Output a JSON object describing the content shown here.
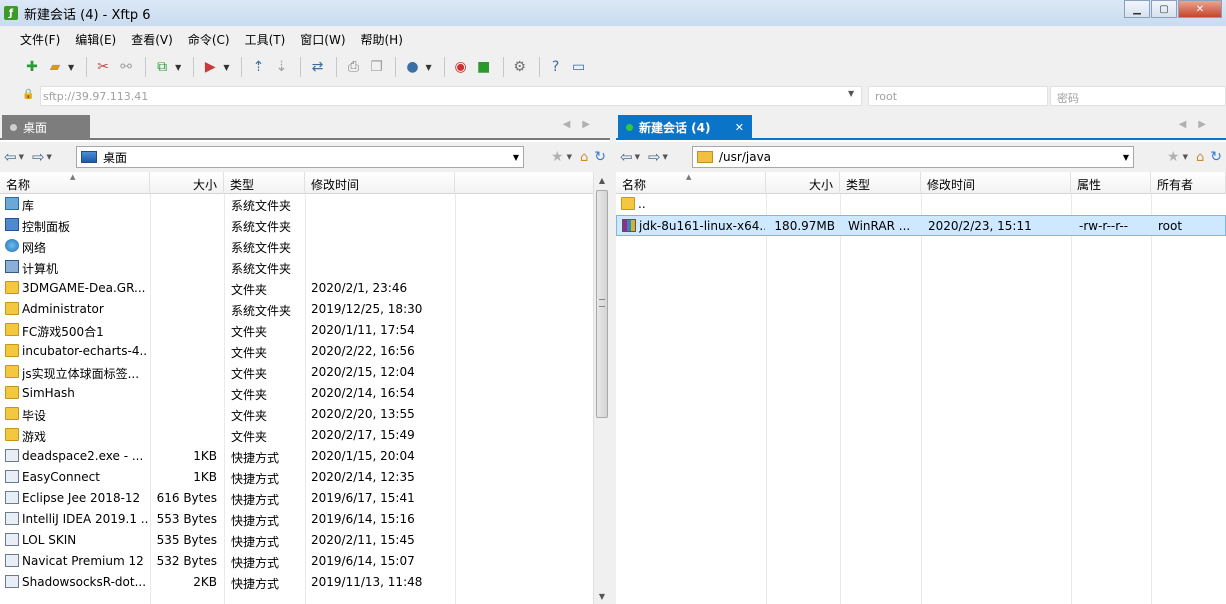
{
  "window": {
    "title": "新建会话 (4) - Xftp 6",
    "app_icon": "xftp-app-icon"
  },
  "menu": [
    "文件(F)",
    "编辑(E)",
    "查看(V)",
    "命令(C)",
    "工具(T)",
    "窗口(W)",
    "帮助(H)"
  ],
  "address": {
    "host": "sftp://39.97.113.41",
    "user_placeholder": "root",
    "password_placeholder": "密码"
  },
  "left": {
    "tab_label": "桌面",
    "path": "桌面",
    "columns": {
      "name": "名称",
      "size": "大小",
      "type": "类型",
      "modified": "修改时间"
    },
    "rows": [
      {
        "icon": "library",
        "name": "库",
        "size": "",
        "type": "系统文件夹",
        "modified": ""
      },
      {
        "icon": "control",
        "name": "控制面板",
        "size": "",
        "type": "系统文件夹",
        "modified": ""
      },
      {
        "icon": "network",
        "name": "网络",
        "size": "",
        "type": "系统文件夹",
        "modified": ""
      },
      {
        "icon": "computer",
        "name": "计算机",
        "size": "",
        "type": "系统文件夹",
        "modified": ""
      },
      {
        "icon": "folder",
        "name": "3DMGAME-Dea.GR...",
        "size": "",
        "type": "文件夹",
        "modified": "2020/2/1, 23:46"
      },
      {
        "icon": "folder",
        "name": "Administrator",
        "size": "",
        "type": "系统文件夹",
        "modified": "2019/12/25, 18:30"
      },
      {
        "icon": "folder",
        "name": "FC游戏500合1",
        "size": "",
        "type": "文件夹",
        "modified": "2020/1/11, 17:54"
      },
      {
        "icon": "folder",
        "name": "incubator-echarts-4...",
        "size": "",
        "type": "文件夹",
        "modified": "2020/2/22, 16:56"
      },
      {
        "icon": "folder",
        "name": "js实现立体球面标签...",
        "size": "",
        "type": "文件夹",
        "modified": "2020/2/15, 12:04"
      },
      {
        "icon": "folder",
        "name": "SimHash",
        "size": "",
        "type": "文件夹",
        "modified": "2020/2/14, 16:54"
      },
      {
        "icon": "folder",
        "name": "毕设",
        "size": "",
        "type": "文件夹",
        "modified": "2020/2/20, 13:55"
      },
      {
        "icon": "folder",
        "name": "游戏",
        "size": "",
        "type": "文件夹",
        "modified": "2020/2/17, 15:49"
      },
      {
        "icon": "shortcut",
        "name": "deadspace2.exe - ...",
        "size": "1KB",
        "type": "快捷方式",
        "modified": "2020/1/15, 20:04"
      },
      {
        "icon": "shortcut",
        "name": "EasyConnect",
        "size": "1KB",
        "type": "快捷方式",
        "modified": "2020/2/14, 12:35"
      },
      {
        "icon": "shortcut",
        "name": "Eclipse Jee 2018-12",
        "size": "616 Bytes",
        "type": "快捷方式",
        "modified": "2019/6/17, 15:41"
      },
      {
        "icon": "shortcut",
        "name": "IntelliJ IDEA 2019.1 ...",
        "size": "553 Bytes",
        "type": "快捷方式",
        "modified": "2019/6/14, 15:16"
      },
      {
        "icon": "shortcut",
        "name": "LOL SKIN",
        "size": "535 Bytes",
        "type": "快捷方式",
        "modified": "2020/2/11, 15:45"
      },
      {
        "icon": "shortcut",
        "name": "Navicat Premium 12",
        "size": "532 Bytes",
        "type": "快捷方式",
        "modified": "2019/6/14, 15:07"
      },
      {
        "icon": "shortcut",
        "name": "ShadowsocksR-dot...",
        "size": "2KB",
        "type": "快捷方式",
        "modified": "2019/11/13, 11:48"
      }
    ]
  },
  "right": {
    "tab_label": "新建会话 (4)",
    "path": "/usr/java",
    "columns": {
      "name": "名称",
      "size": "大小",
      "type": "类型",
      "modified": "修改时间",
      "attrs": "属性",
      "owner": "所有者"
    },
    "rows": [
      {
        "icon": "folder",
        "name": "..",
        "size": "",
        "type": "",
        "modified": "",
        "attrs": "",
        "owner": "",
        "selected": false
      },
      {
        "icon": "archive",
        "name": "jdk-8u161-linux-x64...",
        "size": "180.97MB",
        "type": "WinRAR ...",
        "modified": "2020/2/23, 15:11",
        "attrs": "-rw-r--r--",
        "owner": "root",
        "selected": true
      }
    ]
  }
}
